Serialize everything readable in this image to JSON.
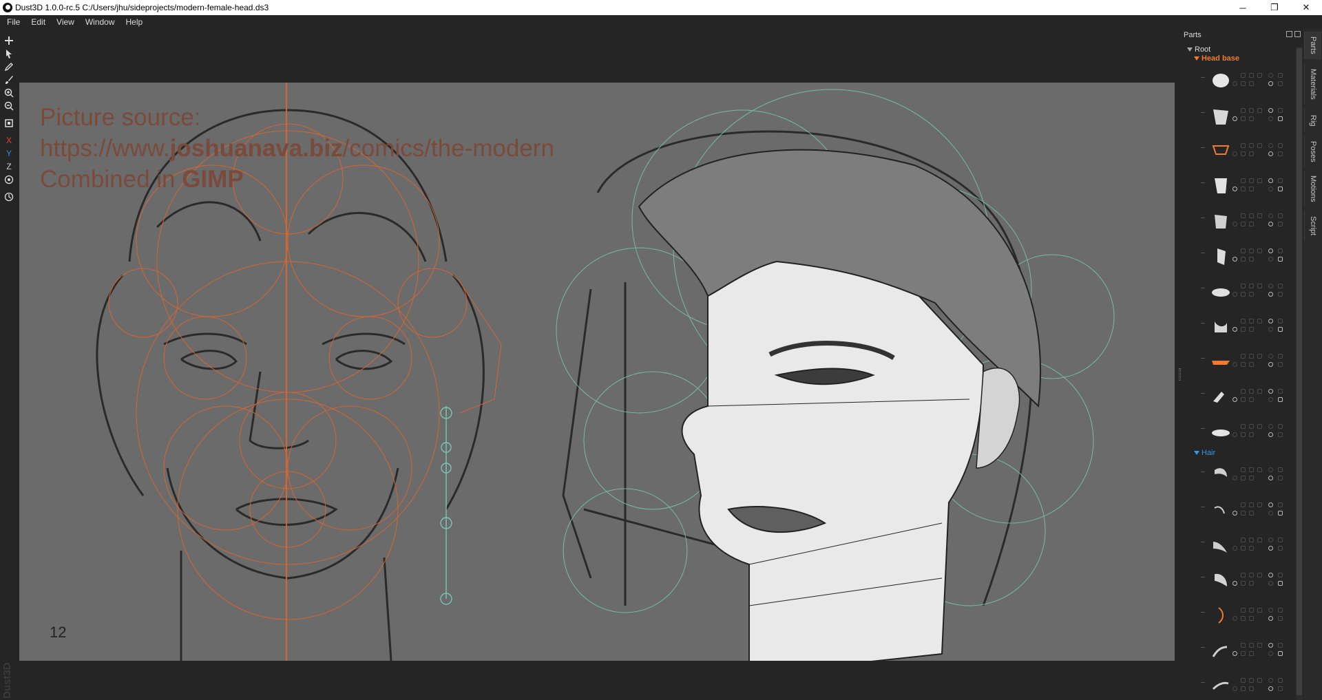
{
  "window": {
    "title": "Dust3D 1.0.0-rc.5 C:/Users/jhu/sideprojects/modern-female-head.ds3",
    "minimize": "─",
    "maximize": "❐",
    "close": "✕"
  },
  "menu": [
    "File",
    "Edit",
    "View",
    "Window",
    "Help"
  ],
  "toolbar": {
    "axis_x": "X",
    "axis_y": "Y",
    "axis_z": "Z",
    "axis_colors": {
      "x": "#e8452a",
      "y": "#2e8ce8",
      "z": "#cfcfcf"
    }
  },
  "canvas": {
    "reference_text": {
      "line1": "Picture source:",
      "line2_prefix": "https://www.",
      "line2_bold": "joshuanava.biz",
      "line2_suffix": "/comics/the-modern",
      "line3_prefix": "Combined in ",
      "line3_bold": "GIMP"
    },
    "page_number": "12",
    "watermark": "Dust3D"
  },
  "parts_panel": {
    "title": "Parts",
    "root_label": "Root",
    "groups": [
      {
        "label": "Head base",
        "color": "#f07a2e",
        "parts": [
          {
            "thumb": "sphere-part-icon"
          },
          {
            "thumb": "cut-block-part-icon"
          },
          {
            "thumb": "chin-curve-part-icon"
          },
          {
            "thumb": "cylinder-part-icon"
          },
          {
            "thumb": "box-part-icon"
          },
          {
            "thumb": "jaw-part-icon"
          },
          {
            "thumb": "nose-part-icon"
          },
          {
            "thumb": "ear-part-icon"
          },
          {
            "thumb": "lip-part-icon"
          },
          {
            "thumb": "bent-part-icon"
          },
          {
            "thumb": "lid-part-icon"
          }
        ]
      },
      {
        "label": "Hair",
        "color": "#2e9ae8",
        "parts": [
          {
            "thumb": "hair-strand-part-icon"
          },
          {
            "thumb": "hair-curl-part-icon"
          },
          {
            "thumb": "hair-tuft-part-icon"
          },
          {
            "thumb": "hair-volume-part-icon"
          },
          {
            "thumb": "hair-curve-part-icon"
          },
          {
            "thumb": "hair-wisp-part-icon"
          },
          {
            "thumb": "hair-flick-part-icon"
          }
        ]
      }
    ]
  },
  "dock_tabs": [
    "Parts",
    "Materials",
    "Rig",
    "Poses",
    "Motions",
    "Script"
  ]
}
